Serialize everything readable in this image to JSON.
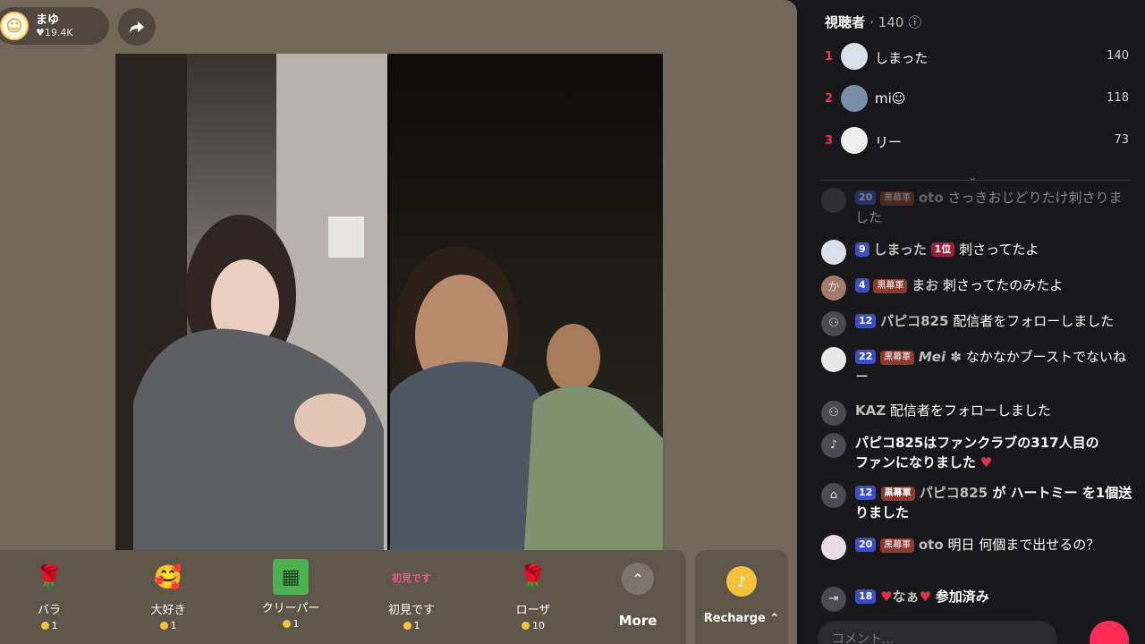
{
  "host": {
    "name": "まゆ",
    "likes": "19.4K"
  },
  "gifts": [
    {
      "name": "バラ",
      "price": "1",
      "icon": "rose-icon",
      "glyph": "🌹"
    },
    {
      "name": "大好き",
      "price": "1",
      "icon": "heart-face-icon",
      "glyph": "🥰"
    },
    {
      "name": "クリーパー",
      "price": "1",
      "icon": "creeper-icon",
      "glyph": "▦"
    },
    {
      "name": "初見です",
      "price": "1",
      "icon": "first-time-sticker-icon",
      "glyph": "初見です"
    },
    {
      "name": "ローザ",
      "price": "10",
      "icon": "rosa-icon",
      "glyph": "🌹"
    }
  ],
  "more_label": "More",
  "recharge_label": "Recharge",
  "viewers": {
    "title": "視聴者",
    "count": "140",
    "ranks": [
      {
        "rank": "1",
        "name": "しまった",
        "score": "140"
      },
      {
        "rank": "2",
        "name": "mi☺",
        "score": "118"
      },
      {
        "rank": "3",
        "name": "リー",
        "score": "73"
      }
    ]
  },
  "chat": [
    {
      "level": "20",
      "fan": "黒幕軍",
      "user": "oto",
      "text": "さっきおじどりたけ刺さりました"
    },
    {
      "level": "9",
      "rank": "1位",
      "user": "しまった",
      "text": "刺さってたよ"
    },
    {
      "level": "4",
      "fan": "黒幕軍",
      "user": "まお",
      "text": "刺さってたのみたよ"
    },
    {
      "level": "12",
      "user": "パピコ825",
      "text": "配信者をフォローしました"
    },
    {
      "level": "22",
      "fan": "黒幕軍",
      "user": "Mei ✽",
      "text": "なかなかブーストでないねー"
    },
    {
      "user": "KAZ",
      "text": "配信者をフォローしました"
    },
    {
      "system": "パピコ825はファンクラブの317人目のファンになりました"
    },
    {
      "level": "12",
      "fan": "黒幕軍",
      "user": "パピコ825",
      "text": "が ハートミー を1個送りました"
    },
    {
      "level": "20",
      "fan": "黒幕軍",
      "user": "oto",
      "text": "明日 何個まで出せるの？"
    },
    {
      "level": "18",
      "user": "なぁ",
      "text": "参加済み"
    }
  ],
  "input_placeholder": "コメント..."
}
